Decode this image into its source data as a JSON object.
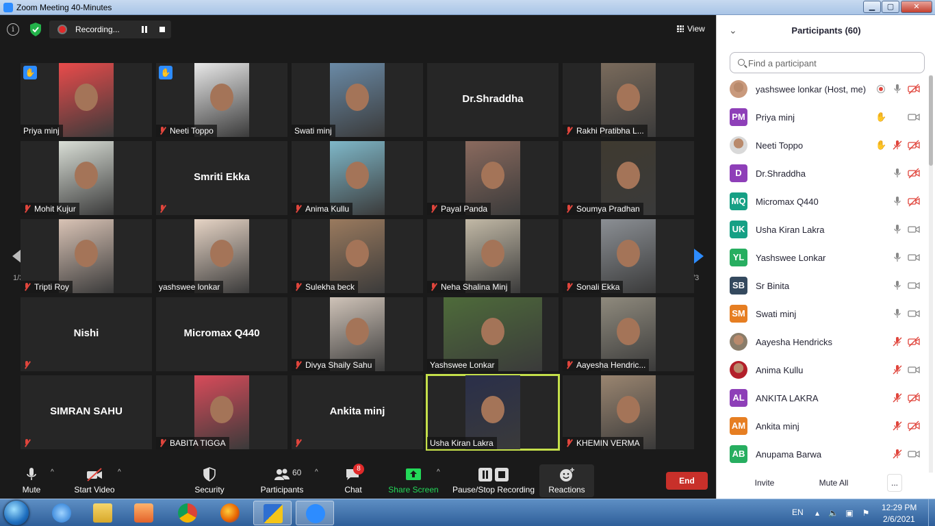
{
  "window": {
    "title": "Zoom Meeting 40-Minutes",
    "minimize": "▁",
    "maximize": "▢",
    "close": "✕"
  },
  "topbar": {
    "info_glyph": "i",
    "recording_label": "Recording...",
    "view_label": "View"
  },
  "gallery": {
    "page_left": "1/3",
    "page_right": "1/3",
    "tiles": [
      {
        "name": "Priya minj",
        "muted": false,
        "hand": true,
        "video": true,
        "photo_color": "#e94b4b"
      },
      {
        "name": "Neeti Toppo",
        "muted": true,
        "hand": true,
        "video": true,
        "photo_color": "#e8e8e8"
      },
      {
        "name": "Swati minj",
        "muted": false,
        "hand": false,
        "video": true,
        "photo_color": "#6a8aa6"
      },
      {
        "name": "Dr.Shraddha",
        "muted": false,
        "hand": false,
        "video": false,
        "center": true,
        "photo_color": ""
      },
      {
        "name": "Rakhi Pratibha L...",
        "muted": true,
        "hand": false,
        "video": true,
        "photo_color": "#7a6b5c"
      },
      {
        "name": "Mohit Kujur",
        "muted": true,
        "hand": false,
        "video": true,
        "photo_color": "#d9ded6"
      },
      {
        "name": "Smriti Ekka",
        "muted": true,
        "hand": false,
        "video": false,
        "center": true,
        "photo_color": ""
      },
      {
        "name": "Anima Kullu",
        "muted": true,
        "hand": false,
        "video": true,
        "photo_color": "#7fb8c9"
      },
      {
        "name": "Payal Panda",
        "muted": true,
        "hand": false,
        "video": true,
        "photo_color": "#8a6a5e"
      },
      {
        "name": "Soumya Pradhan",
        "muted": true,
        "hand": false,
        "video": true,
        "photo_color": "#3f3a30"
      },
      {
        "name": "Tripti Roy",
        "muted": true,
        "hand": false,
        "video": true,
        "photo_color": "#d9c3b5"
      },
      {
        "name": "yashswee lonkar",
        "muted": false,
        "hand": false,
        "video": true,
        "photo_color": "#e6d4c5"
      },
      {
        "name": "Sulekha beck",
        "muted": true,
        "hand": false,
        "video": true,
        "photo_color": "#9a7a5e"
      },
      {
        "name": "Neha Shalina Minj",
        "muted": true,
        "hand": false,
        "video": true,
        "photo_color": "#c2b9a6"
      },
      {
        "name": "Sonali Ekka",
        "muted": true,
        "hand": false,
        "video": true,
        "photo_color": "#8b8f94"
      },
      {
        "name": "Nishi",
        "muted": true,
        "hand": false,
        "video": false,
        "center": true,
        "photo_color": ""
      },
      {
        "name": "Micromax Q440",
        "muted": false,
        "hand": false,
        "video": false,
        "center": true,
        "photo_color": ""
      },
      {
        "name": "Divya Shaily Sahu",
        "muted": true,
        "hand": false,
        "video": true,
        "photo_color": "#cfc3b8"
      },
      {
        "name": "Yashswee Lonkar",
        "muted": false,
        "hand": false,
        "video": true,
        "wide": true,
        "photo_color": "#4e6b3a"
      },
      {
        "name": "Aayesha Hendric...",
        "muted": true,
        "hand": false,
        "video": true,
        "photo_color": "#8f8a7d"
      },
      {
        "name": "SIMRAN SAHU",
        "muted": true,
        "hand": false,
        "video": false,
        "center": true,
        "photo_color": ""
      },
      {
        "name": "BABITA TIGGA",
        "muted": true,
        "hand": false,
        "video": true,
        "photo_color": "#d84b5a"
      },
      {
        "name": "Ankita minj",
        "muted": true,
        "hand": false,
        "video": false,
        "center": true,
        "photo_color": ""
      },
      {
        "name": "Usha Kiran Lakra",
        "muted": false,
        "hand": false,
        "video": true,
        "speaking": true,
        "photo_color": "#2a2f4a"
      },
      {
        "name": "KHEMIN VERMA",
        "muted": true,
        "hand": false,
        "video": true,
        "photo_color": "#9a8570"
      }
    ]
  },
  "toolbar": {
    "mute": "Mute",
    "start_video": "Start Video",
    "security": "Security",
    "participants": "Participants",
    "participants_count": "60",
    "chat": "Chat",
    "chat_badge": "8",
    "share_screen": "Share Screen",
    "pause_stop_recording": "Pause/Stop Recording",
    "reactions": "Reactions",
    "end": "End"
  },
  "panel": {
    "title": "Participants (60)",
    "search_placeholder": "Find a participant",
    "participants": [
      {
        "name": "yashswee lonkar (Host, me)",
        "initials": "",
        "avatar_color": "#c99a7d",
        "photo": true,
        "rec": true,
        "hand": false,
        "mic": "on",
        "video": "off"
      },
      {
        "name": "Priya minj",
        "initials": "PM",
        "avatar_color": "#8e3fb8",
        "photo": false,
        "rec": false,
        "hand": true,
        "mic": "none",
        "video": "on"
      },
      {
        "name": "Neeti Toppo",
        "initials": "",
        "avatar_color": "#d9d9d9",
        "photo": true,
        "rec": false,
        "hand": true,
        "mic": "off",
        "video": "off"
      },
      {
        "name": "Dr.Shraddha",
        "initials": "D",
        "avatar_color": "#8e3fb8",
        "photo": false,
        "rec": false,
        "hand": false,
        "mic": "on",
        "video": "off"
      },
      {
        "name": "Micromax Q440",
        "initials": "MQ",
        "avatar_color": "#16a085",
        "photo": false,
        "rec": false,
        "hand": false,
        "mic": "on",
        "video": "off"
      },
      {
        "name": "Usha Kiran Lakra",
        "initials": "UK",
        "avatar_color": "#16a085",
        "photo": false,
        "rec": false,
        "hand": false,
        "mic": "on-active",
        "video": "on"
      },
      {
        "name": "Yashswee Lonkar",
        "initials": "YL",
        "avatar_color": "#27ae60",
        "photo": false,
        "rec": false,
        "hand": false,
        "mic": "on",
        "video": "on"
      },
      {
        "name": "Sr Binita",
        "initials": "SB",
        "avatar_color": "#34495e",
        "photo": false,
        "rec": false,
        "hand": false,
        "mic": "on",
        "video": "on"
      },
      {
        "name": "Swati minj",
        "initials": "SM",
        "avatar_color": "#e67e22",
        "photo": false,
        "rec": false,
        "hand": false,
        "mic": "on",
        "video": "on"
      },
      {
        "name": "Aayesha Hendricks",
        "initials": "",
        "avatar_color": "#8a7d6a",
        "photo": true,
        "rec": false,
        "hand": false,
        "mic": "off",
        "video": "off"
      },
      {
        "name": "Anima Kullu",
        "initials": "",
        "avatar_color": "#b3202a",
        "photo": true,
        "rec": false,
        "hand": false,
        "mic": "off",
        "video": "on"
      },
      {
        "name": "ANKITA LAKRA",
        "initials": "AL",
        "avatar_color": "#8e3fb8",
        "photo": false,
        "rec": false,
        "hand": false,
        "mic": "off",
        "video": "off"
      },
      {
        "name": "Ankita minj",
        "initials": "AM",
        "avatar_color": "#e67e22",
        "photo": false,
        "rec": false,
        "hand": false,
        "mic": "off",
        "video": "off"
      },
      {
        "name": "Anupama Barwa",
        "initials": "AB",
        "avatar_color": "#27ae60",
        "photo": false,
        "rec": false,
        "hand": false,
        "mic": "off",
        "video": "on"
      }
    ],
    "invite": "Invite",
    "mute_all": "Mute All",
    "more": "..."
  },
  "taskbar": {
    "language": "EN",
    "time": "12:29 PM",
    "date": "2/6/2021"
  },
  "colors": {
    "accent": "#2d8cff",
    "mute_red": "#e0453c",
    "end_red": "#c8302a",
    "share_green": "#23d959",
    "speaker_outline": "#c5e04a"
  }
}
